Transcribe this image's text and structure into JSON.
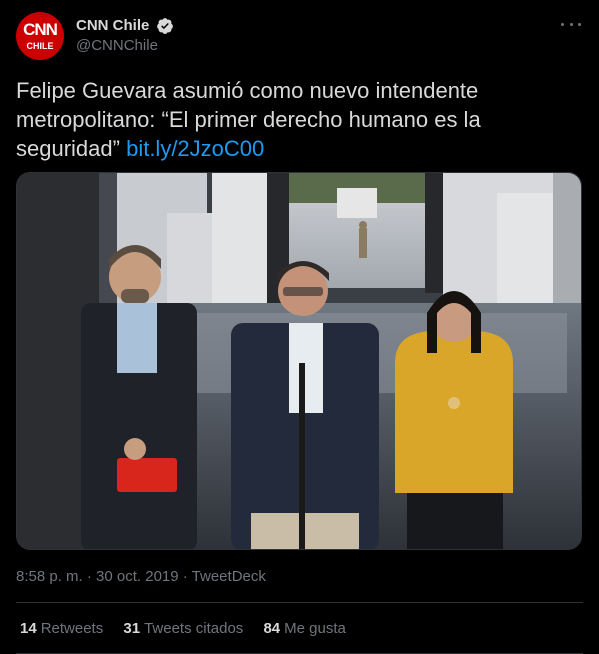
{
  "author": {
    "display_name": "CNN Chile",
    "handle": "@CNNChile",
    "verified": true,
    "avatar_logo_top": "CNN",
    "avatar_logo_bottom": "CHILE"
  },
  "tweet": {
    "text": "Felipe Guevara asumió como nuevo intendente metropolitano: “El primer derecho humano es la seguridad”",
    "link": "bit.ly/2JzoC00",
    "timestamp": "8:58 p. m. · 30 oct. 2019",
    "source": "TweetDeck",
    "separator": " · "
  },
  "stats": [
    {
      "count": "14",
      "label": "Retweets"
    },
    {
      "count": "31",
      "label": "Tweets citados"
    },
    {
      "count": "84",
      "label": "Me gusta"
    }
  ],
  "colors": {
    "background": "#000000",
    "text": "#d9d9d9",
    "muted": "#6e767d",
    "link": "#1d9bf0",
    "verified": "#d9d9d9",
    "avatar": "#cc0000"
  },
  "icons": {
    "verified": "verified-badge-icon",
    "more": "more-dots-icon"
  }
}
